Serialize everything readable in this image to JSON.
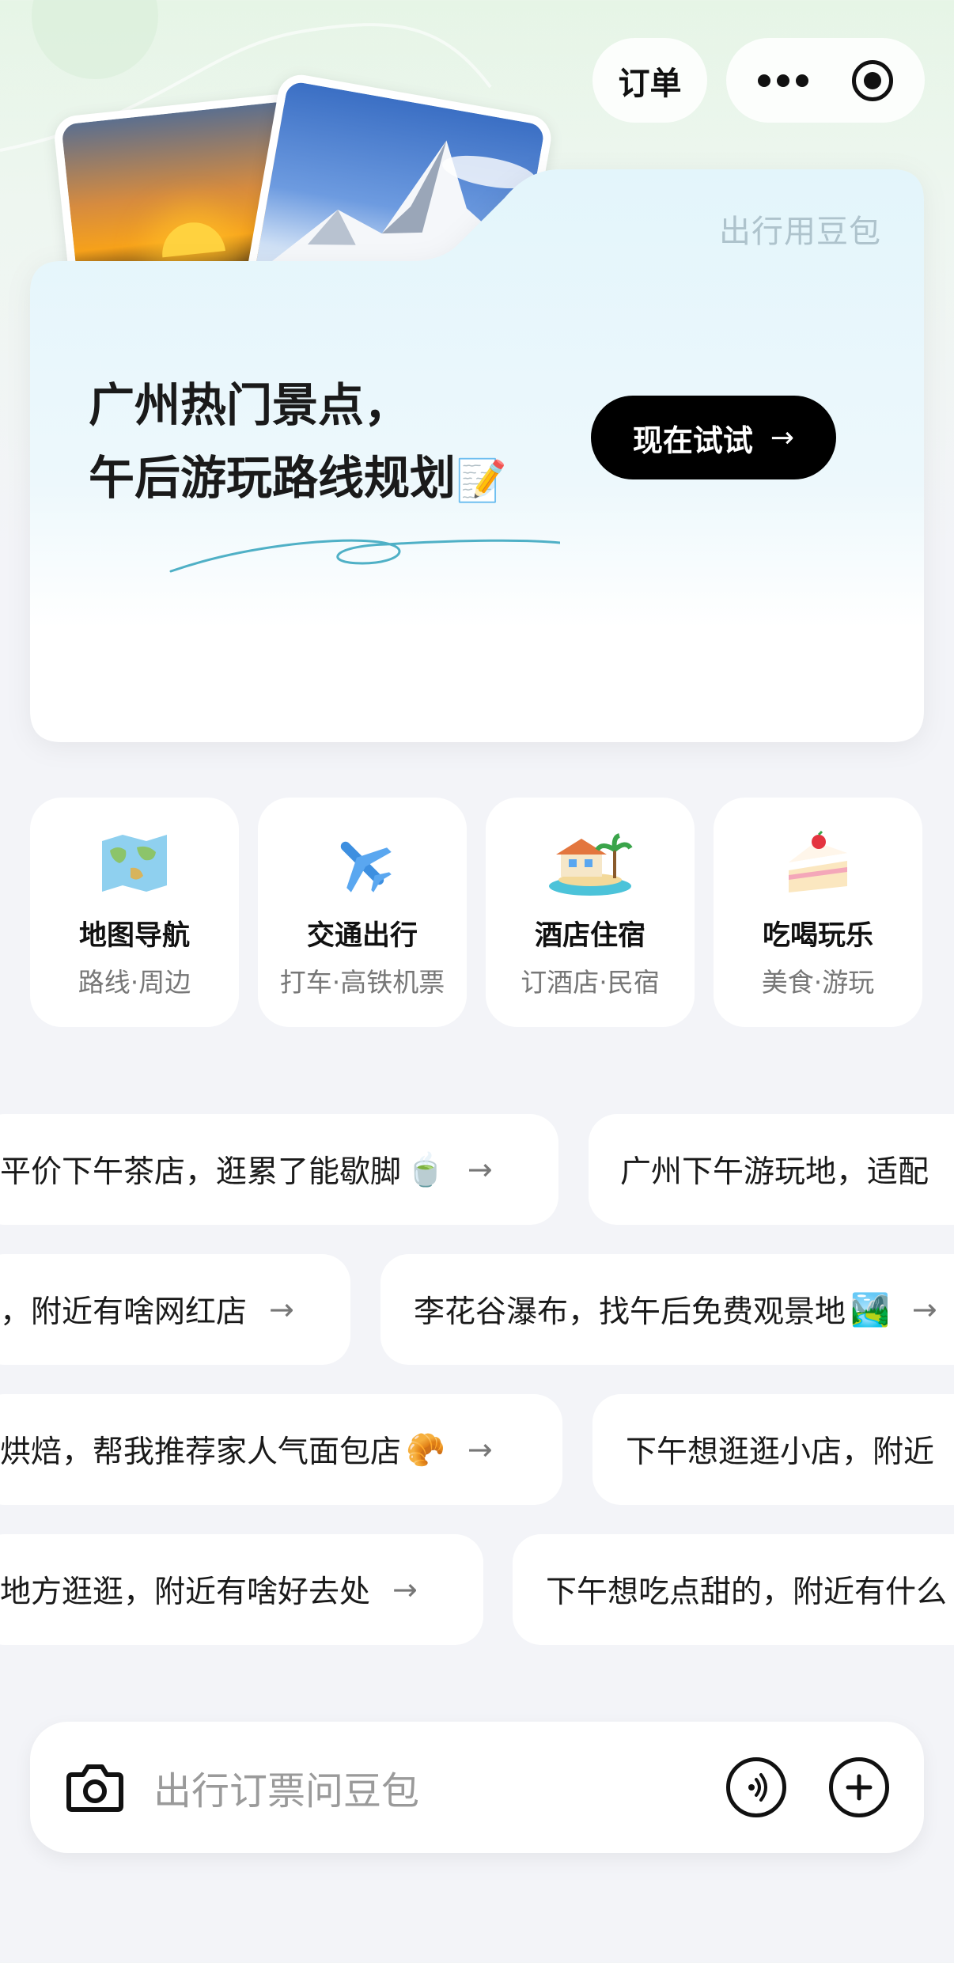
{
  "topbar": {
    "order_label": "订单"
  },
  "hero": {
    "brand": "出行用豆包",
    "title_line1": "广州热门景点，",
    "title_line2": "午后游玩路线规划",
    "cta": "现在试试"
  },
  "tiles": [
    {
      "title": "地图导航",
      "sub": "路线·周边",
      "icon": "world-map-icon"
    },
    {
      "title": "交通出行",
      "sub": "打车·高铁机票",
      "icon": "airplane-icon"
    },
    {
      "title": "酒店住宿",
      "sub": "订酒店·民宿",
      "icon": "beach-hotel-icon"
    },
    {
      "title": "吃喝玩乐",
      "sub": "美食·游玩",
      "icon": "cake-icon"
    }
  ],
  "suggestions": [
    {
      "text": "平价下午茶店，逛累了能歇脚",
      "emoji": "🍵"
    },
    {
      "text": "广州下午游玩地，适配"
    },
    {
      "text": "，附近有啥网红店"
    },
    {
      "text": "李花谷瀑布，找午后免费观景地",
      "emoji": "🏞️"
    },
    {
      "text": "烘焙，帮我推荐家人气面包店",
      "emoji": "🥐"
    },
    {
      "text": "下午想逛逛小店，附近"
    },
    {
      "text": "地方逛逛，附近有啥好去处"
    },
    {
      "text": "下午想吃点甜的，附近有什么"
    }
  ],
  "input": {
    "placeholder": "出行订票问豆包"
  },
  "colors": {
    "accent": "#000000",
    "brand_text": "#aec3cc",
    "hero_top": "#e3f5fb"
  }
}
